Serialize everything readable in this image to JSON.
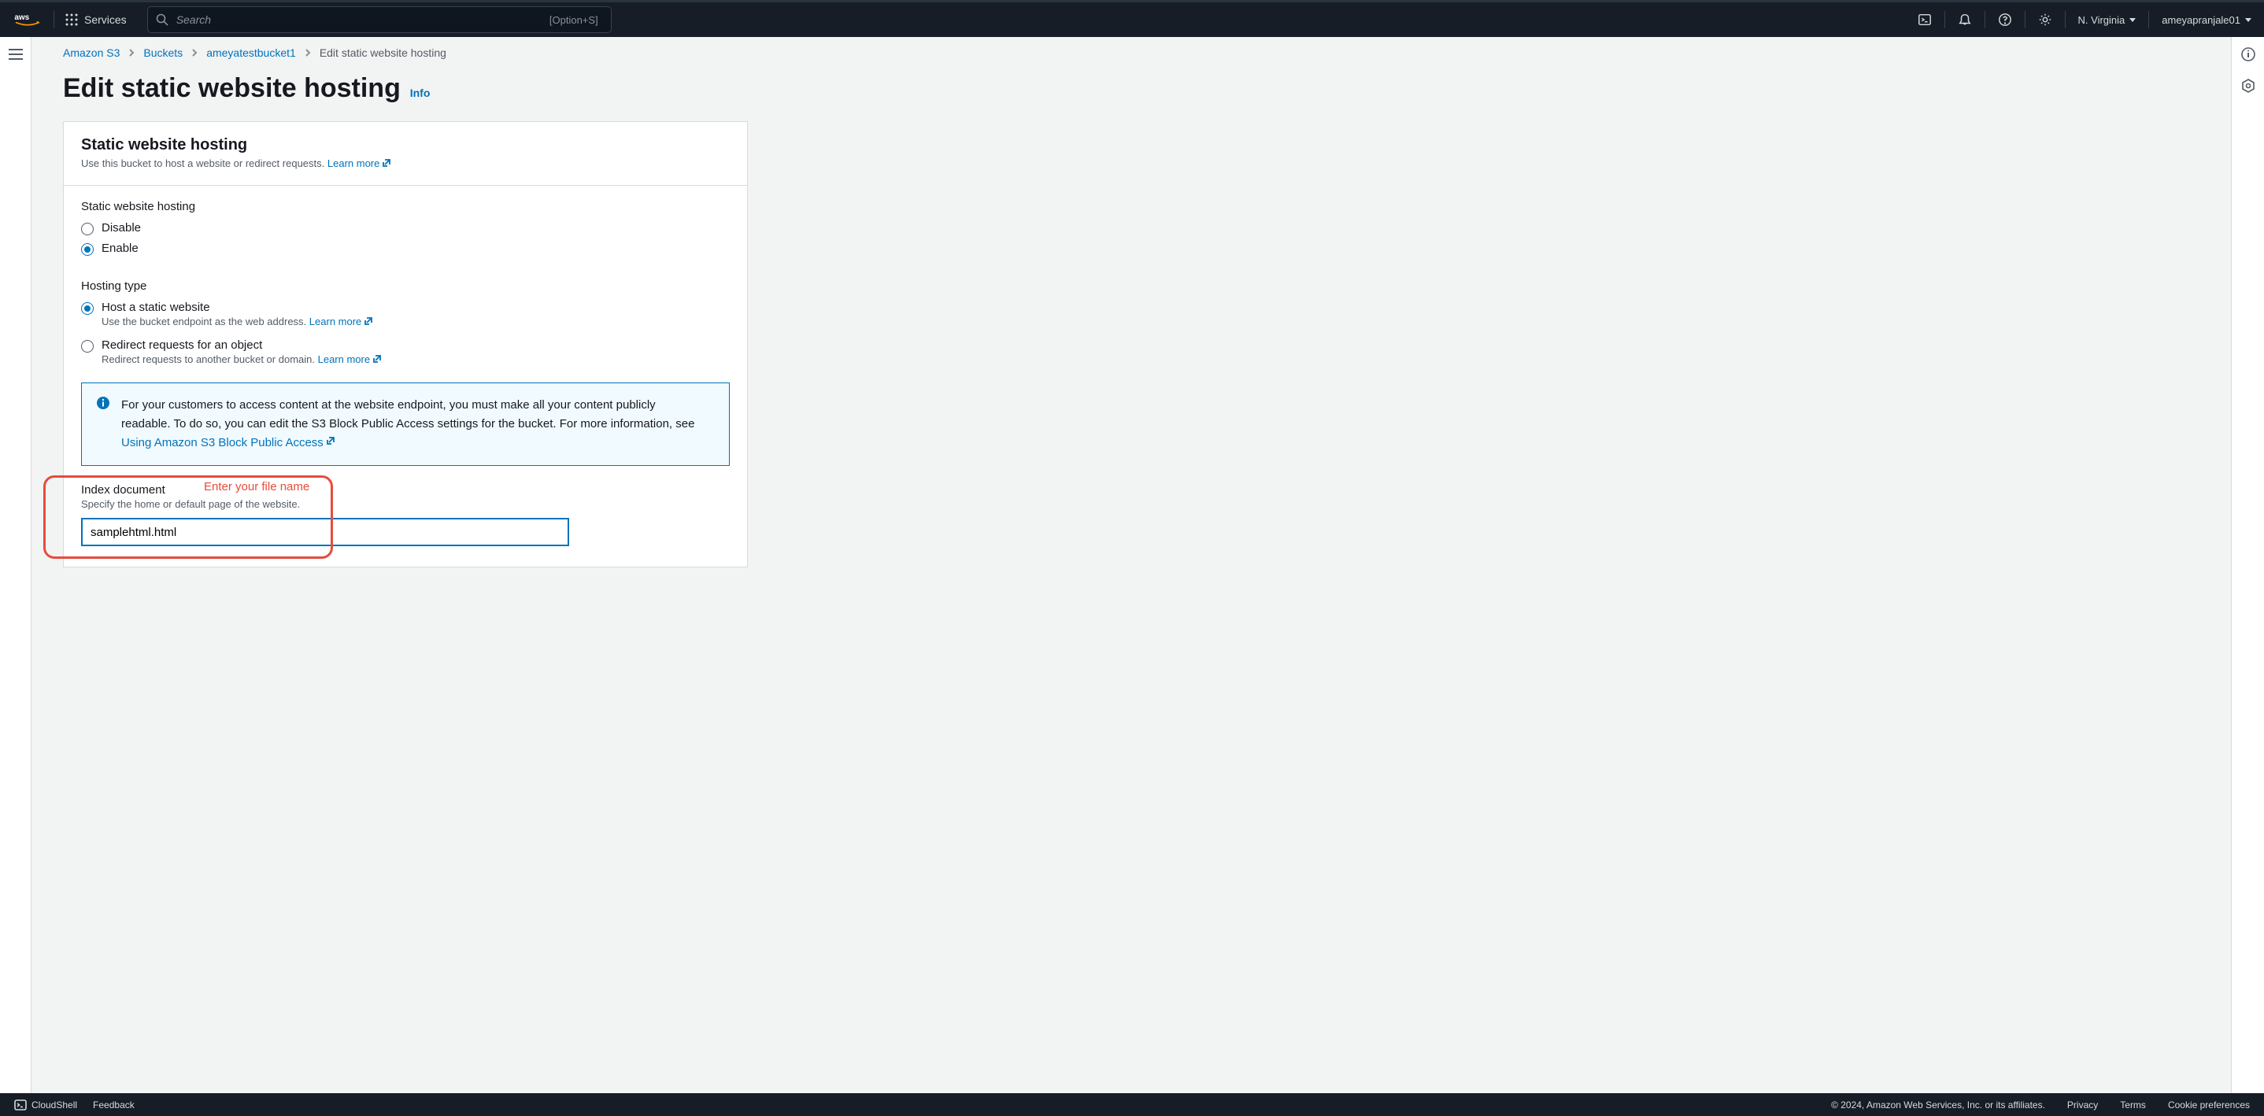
{
  "header": {
    "services_label": "Services",
    "search_placeholder": "Search",
    "search_shortcut": "[Option+S]",
    "region": "N. Virginia",
    "username": "ameyapranjale01"
  },
  "breadcrumb": {
    "root": "Amazon S3",
    "buckets": "Buckets",
    "bucket_name": "ameyatestbucket1",
    "current": "Edit static website hosting"
  },
  "page": {
    "title": "Edit static website hosting",
    "info": "Info"
  },
  "panel": {
    "heading": "Static website hosting",
    "heading_desc": "Use this bucket to host a website or redirect requests.",
    "learn_more": "Learn more",
    "section1_label": "Static website hosting",
    "radio_disable": "Disable",
    "radio_enable": "Enable",
    "section2_label": "Hosting type",
    "host_static_label": "Host a static website",
    "host_static_desc": "Use the bucket endpoint as the web address.",
    "redirect_label": "Redirect requests for an object",
    "redirect_desc": "Redirect requests to another bucket or domain.",
    "info_box": "For your customers to access content at the website endpoint, you must make all your content publicly readable. To do so, you can edit the S3 Block Public Access settings for the bucket. For more information, see ",
    "info_box_link": "Using Amazon S3 Block Public Access",
    "index_doc_label": "Index document",
    "index_doc_desc": "Specify the home or default page of the website.",
    "index_doc_value": "samplehtml.html",
    "annotation": "Enter your file name"
  },
  "footer": {
    "cloudshell": "CloudShell",
    "feedback": "Feedback",
    "copyright": "© 2024, Amazon Web Services, Inc. or its affiliates.",
    "privacy": "Privacy",
    "terms": "Terms",
    "cookie": "Cookie preferences"
  }
}
